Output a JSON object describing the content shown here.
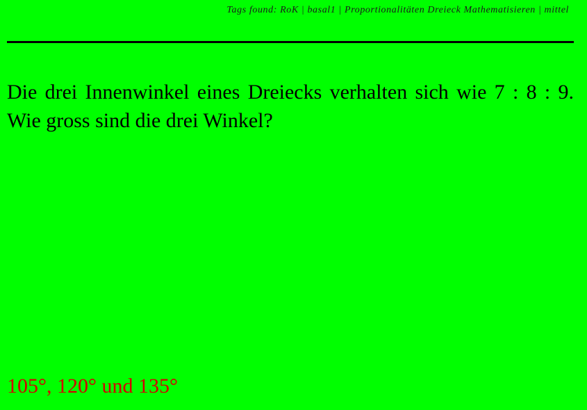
{
  "header": {
    "tags_text": "Tags found: RoK | basal1 | Proportionalitäten Dreieck Mathematisieren | mittel"
  },
  "problem": {
    "question": "Die drei Innenwinkel eines Dreiecks verhalten sich wie 7 : 8 : 9. Wie gross sind die drei Winkel?"
  },
  "solution": {
    "answer": "105°, 120° und 135°"
  },
  "colors": {
    "background": "#00ff00",
    "text": "#000000",
    "answer": "#d40000"
  }
}
